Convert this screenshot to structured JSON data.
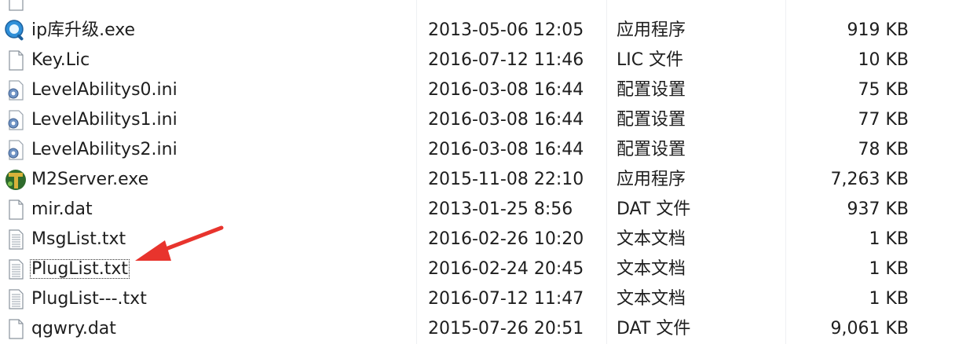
{
  "files": [
    {
      "name": "",
      "date": "",
      "type": "",
      "size": "",
      "icon": "generic-icon"
    },
    {
      "name": "ip库升级.exe",
      "date": "2013-05-06 12:05",
      "type": "应用程序",
      "size": "919 KB",
      "icon": "search-app-icon"
    },
    {
      "name": "Key.Lic",
      "date": "2016-07-12 11:46",
      "type": "LIC 文件",
      "size": "10 KB",
      "icon": "blank-file-icon"
    },
    {
      "name": "LevelAbilitys0.ini",
      "date": "2016-03-08 16:44",
      "type": "配置设置",
      "size": "75 KB",
      "icon": "config-file-icon"
    },
    {
      "name": "LevelAbilitys1.ini",
      "date": "2016-03-08 16:44",
      "type": "配置设置",
      "size": "77 KB",
      "icon": "config-file-icon"
    },
    {
      "name": "LevelAbilitys2.ini",
      "date": "2016-03-08 16:44",
      "type": "配置设置",
      "size": "78 KB",
      "icon": "config-file-icon"
    },
    {
      "name": "M2Server.exe",
      "date": "2015-11-08 22:10",
      "type": "应用程序",
      "size": "7,263 KB",
      "icon": "server-app-icon"
    },
    {
      "name": "mir.dat",
      "date": "2013-01-25 8:56",
      "type": "DAT 文件",
      "size": "937 KB",
      "icon": "blank-file-icon"
    },
    {
      "name": "MsgList.txt",
      "date": "2016-02-26 10:20",
      "type": "文本文档",
      "size": "1 KB",
      "icon": "text-file-icon"
    },
    {
      "name": "PlugList.txt",
      "date": "2016-02-24 20:45",
      "type": "文本文档",
      "size": "1 KB",
      "icon": "text-file-icon",
      "focused": true
    },
    {
      "name": "PlugList---.txt",
      "date": "2016-07-12 11:47",
      "type": "文本文档",
      "size": "1 KB",
      "icon": "text-file-icon"
    },
    {
      "name": "qgwry.dat",
      "date": "2015-07-26 20:51",
      "type": "DAT 文件",
      "size": "9,061 KB",
      "icon": "blank-file-icon"
    }
  ],
  "annotation": {
    "icon": "red-arrow-icon",
    "color": "#e8342d"
  }
}
